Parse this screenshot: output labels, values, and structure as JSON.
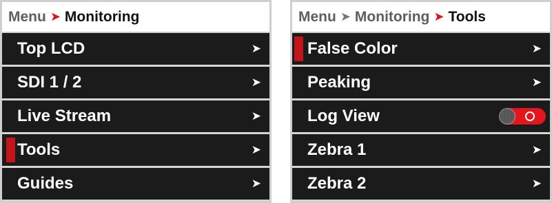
{
  "left_panel": {
    "breadcrumb": {
      "root": "Menu",
      "separator": "➤",
      "current": "Monitoring"
    },
    "items": [
      {
        "label": "Top LCD",
        "chevron": "➤",
        "selected": false
      },
      {
        "label": "SDI 1 / 2",
        "chevron": "➤",
        "selected": false
      },
      {
        "label": "Live Stream",
        "chevron": "➤",
        "selected": false
      },
      {
        "label": "Tools",
        "chevron": "➤",
        "selected": true
      },
      {
        "label": "Guides",
        "chevron": "➤",
        "selected": false
      }
    ]
  },
  "right_panel": {
    "breadcrumb": {
      "root": "Menu",
      "separator1": "➤",
      "middle": "Monitoring",
      "separator2": "➤",
      "current": "Tools"
    },
    "items": [
      {
        "label": "False Color",
        "chevron": "➤",
        "selected": true
      },
      {
        "label": "Peaking",
        "chevron": "➤",
        "selected": false
      },
      {
        "label": "Log View",
        "control": "toggle",
        "toggle_on": true
      },
      {
        "label": "Zebra 1",
        "chevron": "➤",
        "selected": false
      },
      {
        "label": "Zebra 2",
        "chevron": "➤",
        "selected": false
      }
    ]
  },
  "colors": {
    "accent_red": "#d9141f",
    "row_background": "#1b1b1b",
    "row_gap": "#d6d6d6",
    "header_background": "#ffffff"
  }
}
